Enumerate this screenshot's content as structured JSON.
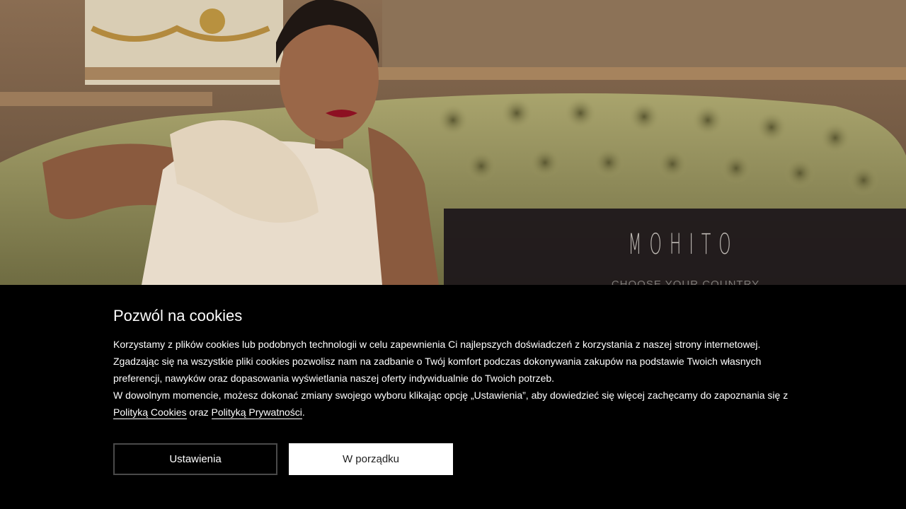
{
  "hero": {
    "image_description": "",
    "brand": "MOHITO",
    "choose_country_label": "CHOOSE YOUR COUNTRY"
  },
  "cookies": {
    "title": "Pozwól na cookies",
    "paragraph1": "Korzystamy z plików cookies lub podobnych technologii w celu zapewnienia Ci najlepszych doświadczeń z korzystania z naszej strony internetowej. Zgadzając się na wszystkie pliki cookies pozwolisz nam na zadbanie o Twój komfort podczas dokonywania zakupów na podstawie Twoich własnych preferencji, nawyków oraz dopasowania wyświetlania naszej oferty indywidualnie do Twoich potrzeb.",
    "paragraph2_start": "W dowolnym momencie, możesz dokonać zmiany swojego wyboru klikając opcję „Ustawienia”, aby dowiedzieć się więcej zachęcamy do zapoznania się z ",
    "cookie_policy_link": "Polityką Cookies",
    "connector": " oraz ",
    "privacy_policy_link": "Polityką Prywatności",
    "end": ".",
    "settings_button": "Ustawienia",
    "accept_button": "W porządku"
  },
  "colors": {
    "banner_bg": "#000000",
    "accept_bg": "#ffffff",
    "panel_bg": "#1c161a"
  }
}
